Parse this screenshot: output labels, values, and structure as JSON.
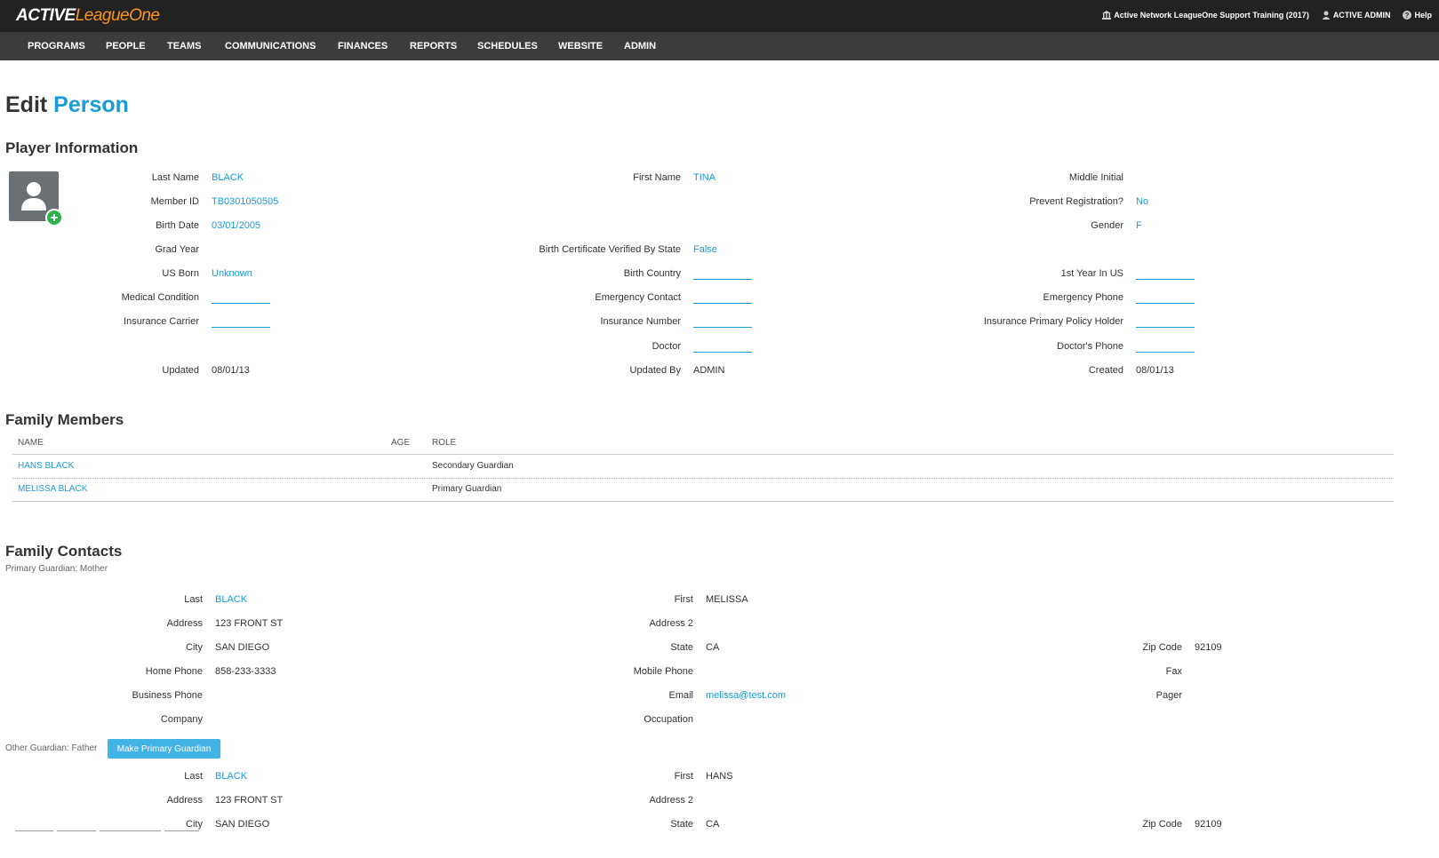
{
  "app": {
    "logo_part1": "ACTIVE",
    "logo_part2": "LeagueOne"
  },
  "toplinks": {
    "org": "Active Network LeagueOne Support Training (2017)",
    "user": "ACTIVE ADMIN",
    "help": "Help"
  },
  "nav": [
    "PROGRAMS",
    "PEOPLE",
    "TEAMS",
    "COMMUNICATIONS",
    "FINANCES",
    "REPORTS",
    "SCHEDULES",
    "WEBSITE",
    "ADMIN"
  ],
  "page": {
    "title_prefix": "Edit",
    "title_accent": "Person"
  },
  "player_info": {
    "heading": "Player Information",
    "col1": [
      {
        "label": "Last Name",
        "value": "BLACK",
        "style": "blue"
      },
      {
        "label": "Member ID",
        "value": "TB0301050505",
        "style": "blue"
      },
      {
        "label": "Birth Date",
        "value": "03/01/2005",
        "style": "blue"
      },
      {
        "label": "Grad Year",
        "value": "",
        "style": "none"
      },
      {
        "label": "US Born",
        "value": "Unknown",
        "style": "blue"
      },
      {
        "label": "Medical Condition",
        "value": "",
        "style": "blank"
      },
      {
        "label": "Insurance Carrier",
        "value": "",
        "style": "blank"
      },
      {
        "label": "",
        "value": "",
        "style": "none"
      },
      {
        "label": "Updated",
        "value": "08/01/13",
        "style": "plain"
      }
    ],
    "col2": [
      {
        "label": "First Name",
        "value": "TINA",
        "style": "blue"
      },
      {
        "label": "",
        "value": "",
        "style": "none"
      },
      {
        "label": "",
        "value": "",
        "style": "none"
      },
      {
        "label": "Birth Certificate Verified By State",
        "value": "False",
        "style": "blue"
      },
      {
        "label": "Birth Country",
        "value": "",
        "style": "blank"
      },
      {
        "label": "Emergency Contact",
        "value": "",
        "style": "blank"
      },
      {
        "label": "Insurance Number",
        "value": "",
        "style": "blank"
      },
      {
        "label": "Doctor",
        "value": "",
        "style": "blank"
      },
      {
        "label": "Updated By",
        "value": "ADMIN",
        "style": "plain"
      }
    ],
    "col3": [
      {
        "label": "Middle Initial",
        "value": "",
        "style": "none"
      },
      {
        "label": "Prevent Registration?",
        "value": "No",
        "style": "blue"
      },
      {
        "label": "Gender",
        "value": "F",
        "style": "blue"
      },
      {
        "label": "",
        "value": "",
        "style": "none"
      },
      {
        "label": "1st Year In US",
        "value": "",
        "style": "blank"
      },
      {
        "label": "Emergency Phone",
        "value": "",
        "style": "blank"
      },
      {
        "label": "Insurance Primary Policy Holder",
        "value": "",
        "style": "blank"
      },
      {
        "label": "Doctor's Phone",
        "value": "",
        "style": "blank"
      },
      {
        "label": "Created",
        "value": "08/01/13",
        "style": "plain"
      }
    ]
  },
  "family_members": {
    "heading": "Family Members",
    "columns": [
      "NAME",
      "AGE",
      "ROLE"
    ],
    "rows": [
      {
        "name": "HANS BLACK",
        "age": "",
        "role": "Secondary Guardian"
      },
      {
        "name": "MELISSA BLACK",
        "age": "",
        "role": "Primary Guardian"
      }
    ]
  },
  "family_contacts": {
    "heading": "Family Contacts",
    "primary_caption": "Primary Guardian: Mother",
    "other_caption": "Other Guardian: Father",
    "make_primary_label": "Make Primary Guardian",
    "primary": {
      "col1": [
        {
          "label": "Last",
          "value": "BLACK",
          "style": "blue"
        },
        {
          "label": "Address",
          "value": "123 FRONT ST",
          "style": "plain"
        },
        {
          "label": "City",
          "value": "SAN DIEGO",
          "style": "plain"
        },
        {
          "label": "Home Phone",
          "value": "858-233-3333",
          "style": "plain"
        },
        {
          "label": "Business Phone",
          "value": "",
          "style": "plain"
        },
        {
          "label": "Company",
          "value": "",
          "style": "plain"
        }
      ],
      "col2": [
        {
          "label": "First",
          "value": "MELISSA",
          "style": "plain"
        },
        {
          "label": "Address 2",
          "value": "",
          "style": "plain"
        },
        {
          "label": "State",
          "value": "CA",
          "style": "plain"
        },
        {
          "label": "Mobile Phone",
          "value": "",
          "style": "plain"
        },
        {
          "label": "Email",
          "value": "melissa@test.com",
          "style": "blue"
        },
        {
          "label": "Occupation",
          "value": "",
          "style": "plain"
        }
      ],
      "col3": [
        {
          "label": "",
          "value": "",
          "style": "none"
        },
        {
          "label": "",
          "value": "",
          "style": "none"
        },
        {
          "label": "Zip Code",
          "value": "92109",
          "style": "plain"
        },
        {
          "label": "Fax",
          "value": "",
          "style": "plain"
        },
        {
          "label": "Pager",
          "value": "",
          "style": "plain"
        },
        {
          "label": "",
          "value": "",
          "style": "none"
        }
      ]
    },
    "other": {
      "col1": [
        {
          "label": "Last",
          "value": "BLACK",
          "style": "blue"
        },
        {
          "label": "Address",
          "value": "123 FRONT ST",
          "style": "plain"
        },
        {
          "label": "City",
          "value": "SAN DIEGO",
          "style": "plain"
        }
      ],
      "col2": [
        {
          "label": "First",
          "value": "HANS",
          "style": "plain"
        },
        {
          "label": "Address 2",
          "value": "",
          "style": "plain"
        },
        {
          "label": "State",
          "value": "CA",
          "style": "plain"
        }
      ],
      "col3": [
        {
          "label": "",
          "value": "",
          "style": "none"
        },
        {
          "label": "",
          "value": "",
          "style": "none"
        },
        {
          "label": "Zip Code",
          "value": "92109",
          "style": "plain"
        }
      ]
    }
  },
  "colors": {
    "accent": "#1a9bd7",
    "topbar": "#222222",
    "navbar": "#3c3c3c",
    "button": "#42b3e5",
    "add": "#2ab24b"
  }
}
